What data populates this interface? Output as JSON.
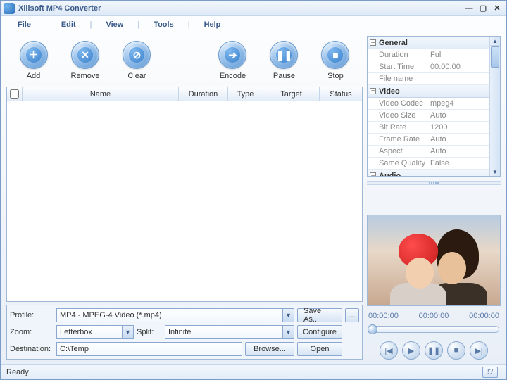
{
  "title": "Xilisoft MP4 Converter",
  "menu": {
    "file": "File",
    "edit": "Edit",
    "view": "View",
    "tools": "Tools",
    "help": "Help"
  },
  "toolbar": {
    "add": "Add",
    "remove": "Remove",
    "clear": "Clear",
    "encode": "Encode",
    "pause": "Pause",
    "stop": "Stop"
  },
  "columns": {
    "name": "Name",
    "duration": "Duration",
    "type": "Type",
    "target": "Target",
    "status": "Status"
  },
  "profile": {
    "label": "Profile:",
    "value": "MP4 - MPEG-4 Video (*.mp4)",
    "saveas": "Save As...",
    "more": "..."
  },
  "zoom": {
    "label": "Zoom:",
    "value": "Letterbox"
  },
  "split": {
    "label": "Split:",
    "value": "Infinite",
    "configure": "Configure"
  },
  "destination": {
    "label": "Destination:",
    "value": "C:\\Temp",
    "browse": "Browse...",
    "open": "Open"
  },
  "props": {
    "general": {
      "title": "General",
      "duration_k": "Duration",
      "duration_v": "Full",
      "start_k": "Start Time",
      "start_v": "00:00:00",
      "file_k": "File name",
      "file_v": ""
    },
    "video": {
      "title": "Video",
      "codec_k": "Video Codec",
      "codec_v": "mpeg4",
      "size_k": "Video Size",
      "size_v": "Auto",
      "bitrate_k": "Bit Rate",
      "bitrate_v": "1200",
      "fps_k": "Frame Rate",
      "fps_v": "Auto",
      "aspect_k": "Aspect",
      "aspect_v": "Auto",
      "sameq_k": "Same Quality",
      "sameq_v": "False"
    },
    "audio": {
      "title": "Audio"
    }
  },
  "time": {
    "t0": "00:00:00",
    "t1": "00:00:00",
    "t2": "00:00:00"
  },
  "status": "Ready",
  "glyph": {
    "plus": "＋",
    "x": "✕",
    "no": "⊘",
    "arrow": "➔",
    "pause": "❚❚",
    "stop": "■",
    "prev": "|◀",
    "play": "▶",
    "next": "▶|",
    "minus": "−"
  }
}
